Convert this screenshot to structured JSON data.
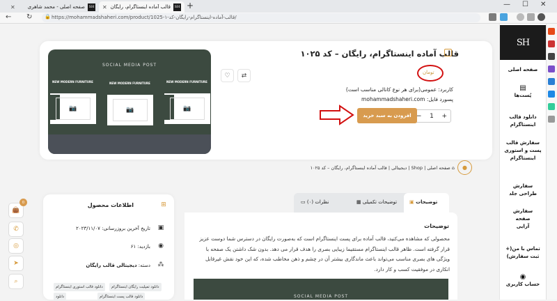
{
  "browser": {
    "tabs": [
      {
        "label": "صفحه اصلی - محمد شاهری",
        "favicon": "SH"
      },
      {
        "label": "قالب آماده اینستاگرام، رایگان - کد ۱",
        "favicon": "SH"
      }
    ],
    "url": "https://mohammadshaheri.com/product/1025-قالب-آماده-اینستاگرام-رایگان-کد-۱/"
  },
  "sidebar": {
    "logo": "SH",
    "items": [
      {
        "label": "صفحه اصلی",
        "icon": "home-icon"
      },
      {
        "label": "پُست‌ها",
        "icon": "news-icon"
      },
      {
        "label": "دانلود قالب اینستاگرام",
        "icon": "download-icon"
      },
      {
        "label": "سفارش قالب پست و استوری اینستاگرام",
        "icon": "order-icon"
      },
      {
        "label": "سفارش طراحی جلد",
        "icon": "cover-icon"
      },
      {
        "label": "سفارش صفحه آرایی",
        "icon": "layout-icon"
      },
      {
        "label": "تماس با من(+ ثبت سفارش)",
        "icon": "phone-icon"
      },
      {
        "label": "حساب کاربری",
        "icon": "user-icon"
      }
    ]
  },
  "product": {
    "title": "قالب آماده اینستاگرام، رایگان – کد ۱۰۲۵",
    "price": "تومان",
    "category": "کاربرد: عمومی(برای هر نوع کانالی مناسب است)",
    "password": "پسورد فایل: mohammadshaheri.com",
    "quantity": "1",
    "add_to_cart": "افزودن به سبد خرید",
    "image_title": "SOCIAL MEDIA POST",
    "poster_text": "NEW MODERN FURNITURE"
  },
  "breadcrumb": [
    "صفحه اصلی",
    "Shop",
    "دیجیتالی",
    "قالب آماده اینستاگرام، رایگان – کد ۱۰۲۵"
  ],
  "tabs": [
    {
      "label": "توضیحات"
    },
    {
      "label": "توضیحات تکمیلی"
    },
    {
      "label": "نظرات (۰)"
    }
  ],
  "description": {
    "title": "توضیحات",
    "text": "محصولی که مشاهده می‌کنید، قالب آماده برای پست اینستاگرام است که به‌صورت رایگان در دسترس شما دوست عزیز قرار گرفته است. ظاهر قالب اینستاگرام مستقیما زیبایی بصری را هدف قرار می دهد. بدون شک داشتن یک صفحه با ویژگی های بصری مناسب می‌تواند باعث ماندگاری بیشتر آن در چشم و ذهن مخاطب شده، که این خود نقش غیرقابل انکاری در موفقیت کسب و کار دارد.",
    "image_title": "SOCIAL MEDIA POST"
  },
  "info": {
    "title": "اطلاعات محصول",
    "updated": "تاریخ آخرین بروزرسانی: ۲۰۲۳/۱۱/۰۷",
    "views": "بازدید: ۶۱",
    "category_label": "دسته:",
    "category_value": "دیجیتالی قالب رایگان",
    "tags": [
      "دانلود تمپلیت رایگان اینستاگرام",
      "دانلود قالب استوری اینستاگرام",
      "دانلود قالب پست اینستاگرام",
      "دانلود"
    ]
  },
  "floating": {
    "cart_count": "0"
  },
  "colors": {
    "accent": "#d89b4f",
    "dark": "#1b1b1b",
    "annotation": "#d21010"
  }
}
